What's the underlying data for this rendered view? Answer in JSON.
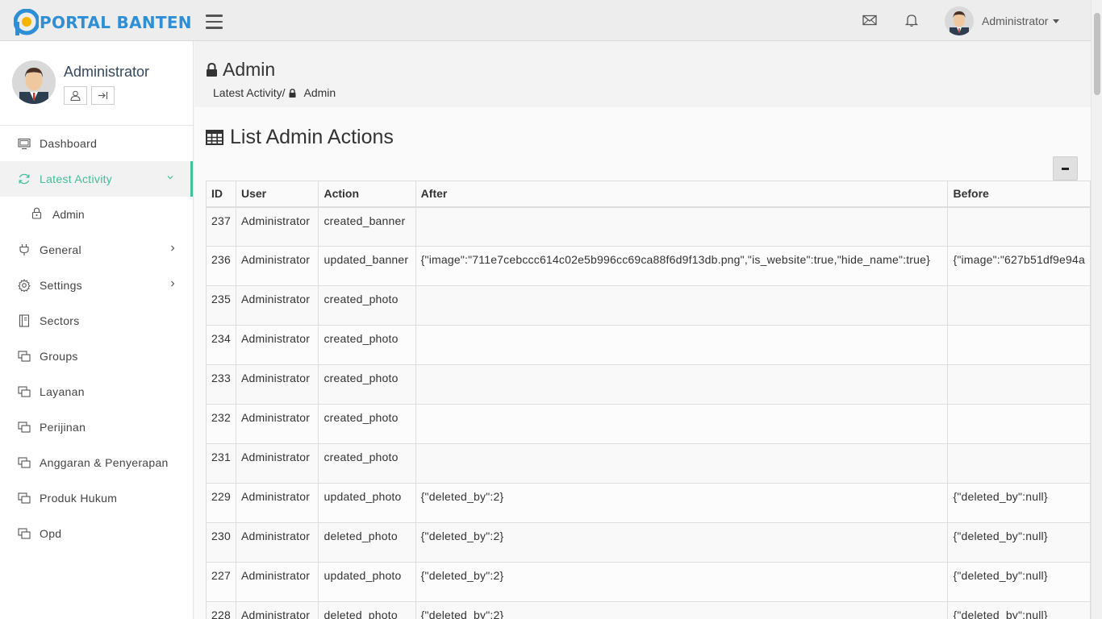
{
  "brand": {
    "name": "PORTAL BANTEN",
    "color": "#2e8fd6"
  },
  "topbar": {
    "username": "Administrator",
    "icons": [
      "hamburger-icon",
      "mail-icon",
      "bell-icon"
    ]
  },
  "sidebar": {
    "profile_name": "Administrator",
    "accent": "#3fbf9a",
    "items": [
      {
        "label": "Dashboard",
        "icon": "monitor-icon"
      },
      {
        "label": "Latest Activity",
        "icon": "refresh-icon"
      },
      {
        "label": "Admin",
        "icon": "lock-icon"
      },
      {
        "label": "General",
        "icon": "plug-icon"
      },
      {
        "label": "Settings",
        "icon": "gear-icon"
      },
      {
        "label": "Sectors",
        "icon": "book-icon"
      },
      {
        "label": "Groups",
        "icon": "windows-icon"
      },
      {
        "label": "Layanan",
        "icon": "windows-icon"
      },
      {
        "label": "Perijinan",
        "icon": "windows-icon"
      },
      {
        "label": "Anggaran & Penyerapan",
        "icon": "windows-icon"
      },
      {
        "label": "Produk Hukum",
        "icon": "windows-icon"
      },
      {
        "label": "Opd",
        "icon": "windows-icon"
      }
    ]
  },
  "page": {
    "title": "Admin",
    "breadcrumb_parent": "Latest Activity/",
    "breadcrumb_current": "Admin",
    "panel_title": "List Admin Actions"
  },
  "table": {
    "headers": [
      "ID",
      "User",
      "Action",
      "After",
      "Before"
    ],
    "rows": [
      [
        "237",
        "Administrator",
        "created_banner",
        "",
        ""
      ],
      [
        "236",
        "Administrator",
        "updated_banner",
        "{\"image\":\"711e7cebccc614c02e5b996cc69ca88f6d9f13db.png\",\"is_website\":true,\"hide_name\":true}",
        "{\"image\":\"627b51df9e94a"
      ],
      [
        "235",
        "Administrator",
        "created_photo",
        "",
        ""
      ],
      [
        "234",
        "Administrator",
        "created_photo",
        "",
        ""
      ],
      [
        "233",
        "Administrator",
        "created_photo",
        "",
        ""
      ],
      [
        "232",
        "Administrator",
        "created_photo",
        "",
        ""
      ],
      [
        "231",
        "Administrator",
        "created_photo",
        "",
        ""
      ],
      [
        "229",
        "Administrator",
        "updated_photo",
        "{\"deleted_by\":2}",
        "{\"deleted_by\":null}"
      ],
      [
        "230",
        "Administrator",
        "deleted_photo",
        "{\"deleted_by\":2}",
        "{\"deleted_by\":null}"
      ],
      [
        "227",
        "Administrator",
        "updated_photo",
        "{\"deleted_by\":2}",
        "{\"deleted_by\":null}"
      ],
      [
        "228",
        "Administrator",
        "deleted_photo",
        "{\"deleted_by\":2}",
        "{\"deleted_by\":null}"
      ]
    ]
  }
}
